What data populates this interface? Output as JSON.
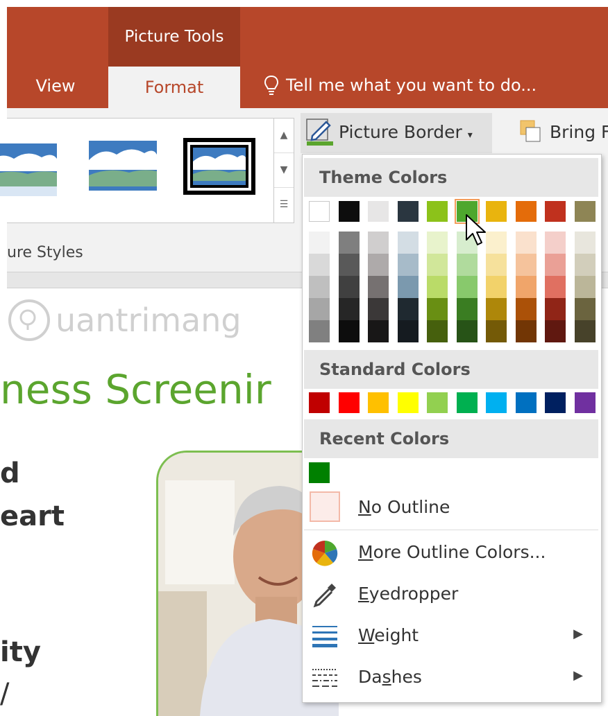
{
  "ribbon": {
    "contextual_label": "Picture Tools",
    "tab_view": "View",
    "tab_format": "Format",
    "tell_me": "Tell me what you want to do...",
    "styles_group_label": "ure Styles",
    "picture_border_label": "Picture Border",
    "bring_forward_label": "Bring F"
  },
  "slide": {
    "title_fragment": "ness Screenir",
    "watermark": "uantrimang",
    "text_lines": [
      "d",
      "eart",
      "ity",
      "/"
    ]
  },
  "dropdown": {
    "theme_colors_header": "Theme Colors",
    "standard_colors_header": "Standard Colors",
    "recent_colors_header": "Recent Colors",
    "theme_row": [
      "#FFFFFF",
      "#0D0D0D",
      "#E7E6E6",
      "#2A3640",
      "#8CC21A",
      "#4EA72E",
      "#E9B40E",
      "#E46C0A",
      "#C0311E",
      "#8E8555"
    ],
    "theme_shades": [
      [
        "#F2F2F2",
        "#D9D9D9",
        "#BFBFBF",
        "#A6A6A6",
        "#808080"
      ],
      [
        "#7F7F7F",
        "#595959",
        "#404040",
        "#262626",
        "#0D0D0D"
      ],
      [
        "#D0CECE",
        "#AEAAAA",
        "#767171",
        "#3B3838",
        "#181717"
      ],
      [
        "#D3DDE4",
        "#A7BBC9",
        "#7B99AE",
        "#1F2930",
        "#151B20"
      ],
      [
        "#E8F3CC",
        "#D1E79A",
        "#BADB68",
        "#698F13",
        "#46600D"
      ],
      [
        "#D7EDCE",
        "#B0DB9D",
        "#88C96C",
        "#3A7D22",
        "#275317"
      ],
      [
        "#FBF0CD",
        "#F6E19C",
        "#F2D26A",
        "#AE870A",
        "#745A07"
      ],
      [
        "#FAE1CD",
        "#F5C39C",
        "#F0A56A",
        "#AB5108",
        "#723605"
      ],
      [
        "#F4CFCA",
        "#EAA096",
        "#E07061",
        "#902517",
        "#601810"
      ],
      [
        "#E8E6DD",
        "#D2CEBB",
        "#BBB699",
        "#6B643F",
        "#47422A"
      ]
    ],
    "standard_colors": [
      "#C00000",
      "#FF0000",
      "#FFC000",
      "#FFFF00",
      "#92D050",
      "#00B050",
      "#00B0F0",
      "#0070C0",
      "#002060",
      "#7030A0"
    ],
    "recent_colors": [
      "#008000"
    ],
    "no_outline": "No Outline",
    "no_outline_key": "N",
    "no_outline_rest": "o Outline",
    "more_colors_key": "M",
    "more_colors_rest": "ore Outline Colors...",
    "eyedropper_key": "E",
    "eyedropper_rest": "yedropper",
    "weight_key": "W",
    "weight_rest": "eight",
    "dashes_pre": "Da",
    "dashes_key": "s",
    "dashes_post": "hes",
    "submenu_arrow": "▶"
  },
  "colors": {
    "accent": "#B7472A",
    "slide_green": "#5BA52E",
    "selected_swatch_border": "#F39C5A"
  }
}
